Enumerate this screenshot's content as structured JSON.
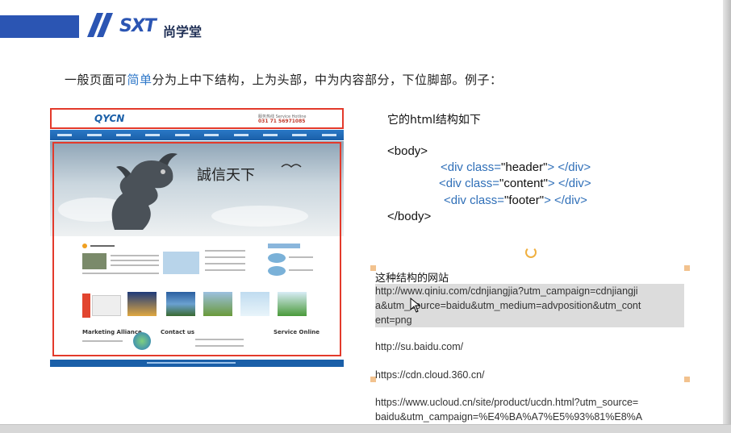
{
  "brand": {
    "logo_text": "SXT",
    "logo_cn": "尚学堂"
  },
  "intro": {
    "part1": "一般页面可",
    "highlight": "简单",
    "part2": "分为上中下结构，上为头部，中为内容部分，下位脚部。例子："
  },
  "example_site": {
    "logo": "QYCN",
    "phone_label": "服务热线 Service Hotline",
    "phone": "031 71 56971085",
    "slogan": "誠信天下",
    "sections": [
      "Marketing Alliance",
      "Contact us",
      "Service Online"
    ]
  },
  "structure": {
    "title": "它的html结构如下",
    "body_open": "<body>",
    "lines": [
      {
        "open": "<div class=",
        "value": "\"header\"",
        "close": "> </div>"
      },
      {
        "open": "<div class=",
        "value": "\"content\"",
        "close": "> </div>"
      },
      {
        "open": "<div class=",
        "value": "\"footer\"",
        "close": "> </div>"
      }
    ],
    "body_close": "</body>"
  },
  "sites": {
    "title": "这种结构的网站",
    "urls": [
      "http://www.qiniu.com/cdnjiangjia?utm_campaign=cdnjiangjia&utm_source=baidu&utm_medium=advposition&utm_content=png",
      "http://su.baidu.com/",
      "https://cdn.cloud.360.cn/",
      "https://www.ucloud.cn/site/product/ucdn.html?utm_source=baidu&utm_campaign=%E4%BA%A7%E5%93%81%E8%A"
    ],
    "url1_lines": [
      "http://www.qiniu.com/cdnjiangjia?utm_campaign=cdnjiangji",
      "a&utm_source=baidu&utm_medium=advposition&utm_cont",
      "ent=png"
    ],
    "url4_lines": [
      "https://www.ucloud.cn/site/product/ucdn.html?utm_source=",
      "baidu&utm_campaign=%E4%BA%A7%E5%93%81%E8%A"
    ]
  },
  "colors": {
    "accent": "#2b55b3",
    "highlight": "#2f78c9",
    "box_red": "#e33a2b",
    "selection": "#dcdcdc"
  }
}
